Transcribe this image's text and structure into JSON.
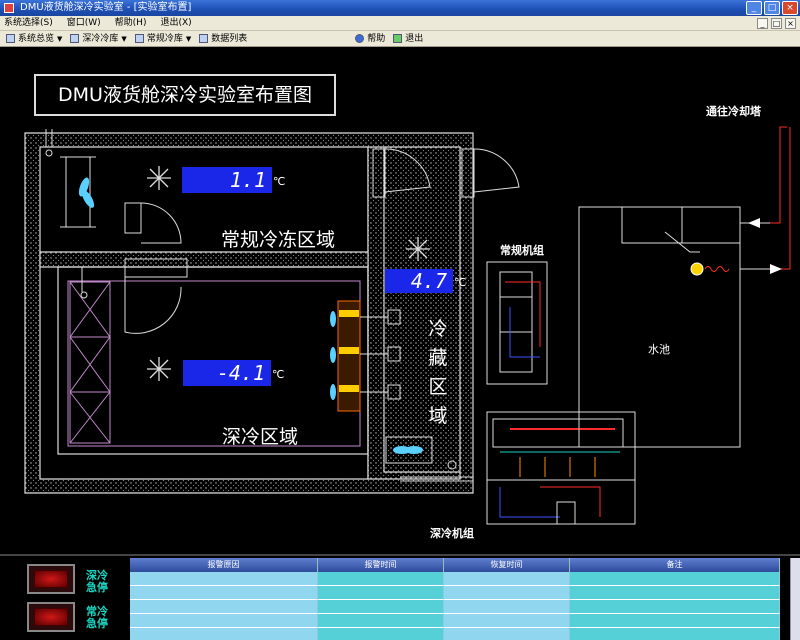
{
  "window": {
    "title": "DMU液货舱深冷实验室 - [实验室布置]",
    "controls": [
      "_",
      "□",
      "×"
    ]
  },
  "menu": {
    "items": [
      "系统选择(S)",
      "窗口(W)",
      "帮助(H)",
      "退出(X)"
    ],
    "mdi_controls": [
      "_",
      "□",
      "×"
    ]
  },
  "toolbar": {
    "items": [
      {
        "label": "系统总览",
        "icon": "overview-icon",
        "dropdown": true
      },
      {
        "label": "深冷冷库",
        "icon": "deep-freeze-icon",
        "dropdown": true
      },
      {
        "label": "常规冷库",
        "icon": "cold-storage-icon",
        "dropdown": true
      },
      {
        "label": "数据列表",
        "icon": "data-list-icon",
        "dropdown": false
      },
      {
        "label": "帮助",
        "icon": "help-icon",
        "dropdown": false
      },
      {
        "label": "退出",
        "icon": "exit-icon",
        "dropdown": false
      }
    ]
  },
  "plan": {
    "title": "DMU液货舱深冷实验室布置图",
    "zones": {
      "regular_freeze": "常规冷冻区域",
      "deep_freeze": "深冷区域",
      "refrigerated": [
        "冷",
        "藏",
        "区",
        "域"
      ],
      "pool": "水池"
    },
    "labels": {
      "cooling_tower": "通往冷却塔",
      "regular_unit": "常规机组",
      "deep_unit": "深冷机组"
    },
    "temps": {
      "regular_freeze": "1.1",
      "refrigerated": "4.7",
      "deep_freeze": "-4.1",
      "unit": "℃"
    }
  },
  "bottom": {
    "estop_deep": "深冷急停",
    "estop_regular": "常冷急停",
    "columns": [
      "报警原因",
      "报警时间",
      "恢复时间",
      "备注"
    ]
  },
  "colors": {
    "temp_bg": "#1b27e8",
    "wall": "#ffffff",
    "pipe_red": "#ff2a2a",
    "estop_text": "#1ad3c0"
  }
}
